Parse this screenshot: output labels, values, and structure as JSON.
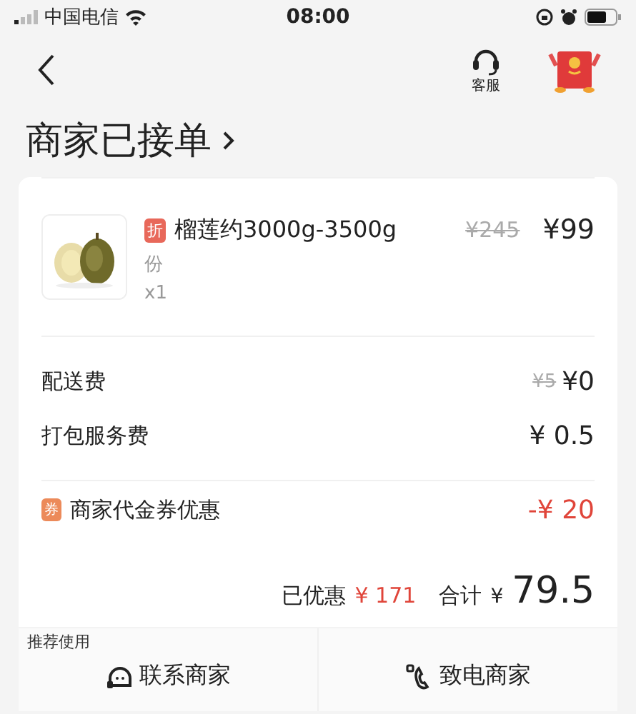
{
  "status_bar": {
    "carrier": "中国电信",
    "time": "08:00"
  },
  "nav": {
    "service_label": "客服"
  },
  "title": "商家已接单",
  "item": {
    "tag": "折",
    "name": "榴莲约3000g-3500g",
    "unit": "份",
    "quantity": "x1",
    "original_price": "¥245",
    "price": "¥99"
  },
  "fees": [
    {
      "kind": "fee",
      "label": "配送费",
      "original": "¥5",
      "value": "¥0"
    },
    {
      "kind": "fee",
      "label": "打包服务费",
      "value": "¥ 0.5"
    }
  ],
  "discount": {
    "badge": "券",
    "label": "商家代金券优惠",
    "value": "-¥ 20"
  },
  "summary": {
    "saved_label": "已优惠",
    "saved": "¥ 171",
    "total_label": "合计",
    "total_currency": "¥",
    "total": "79.5"
  },
  "actions": {
    "hint": "推荐使用",
    "buttons": [
      {
        "kind": "chat",
        "label": "联系商家"
      },
      {
        "kind": "phone",
        "label": "致电商家"
      }
    ]
  }
}
